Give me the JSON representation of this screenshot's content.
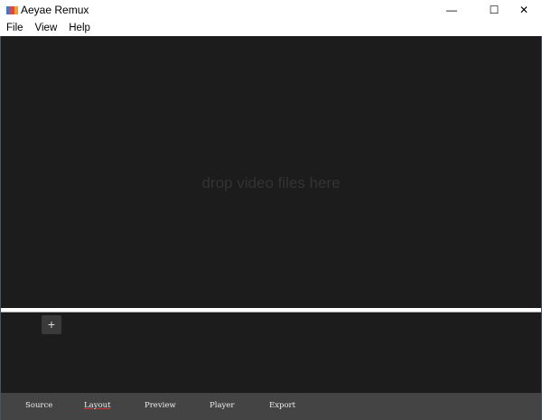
{
  "window": {
    "title": "Aeyae Remux",
    "minimize": "—",
    "maximize": "☐",
    "close": "✕"
  },
  "menu": [
    "File",
    "View",
    "Help"
  ],
  "main": {
    "drop_hint": "drop video files here",
    "add_label": "+"
  },
  "tabs": [
    {
      "label": "Source"
    },
    {
      "label": "Layout",
      "active": true
    },
    {
      "label": "Preview"
    },
    {
      "label": "Player"
    },
    {
      "label": "Export"
    }
  ],
  "colors": {
    "background": "#1c1c1c",
    "tabbar": "#444444"
  }
}
